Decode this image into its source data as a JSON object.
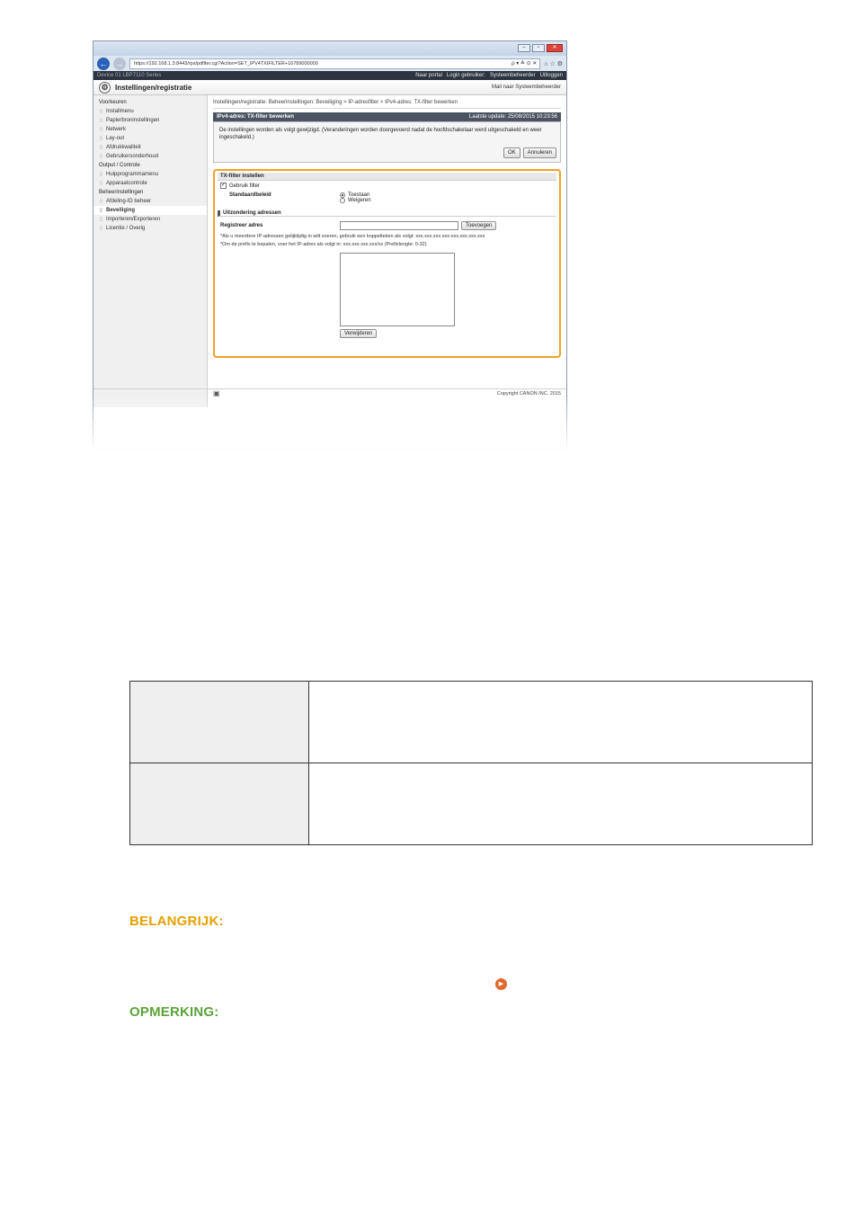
{
  "browser": {
    "url": "https://192.168.1.3:8443/rps/pdflter.cgi?Action=SET_IPV4TXIFILTER+16789000000",
    "addr_tools": "ρ ▾ ≙ ⊙ ✕",
    "tab_icons": "⌂ ☆ ⚙",
    "win_buttons": [
      "–",
      "▫",
      "✕"
    ]
  },
  "topbar": {
    "device": "Device 01   LBP7110 Series",
    "links": [
      "Naar portal",
      "Login gebruiker:",
      "Systeembeheerder",
      "Uitloggen"
    ]
  },
  "app": {
    "title": "Instellingen/registratie",
    "home_link": "Mail naar Systeembeheerder"
  },
  "sidebar": {
    "groups": [
      {
        "label": "Voorkeuren",
        "items": [
          "Installmenu",
          "Papierbroninstellingen",
          "Netwerk",
          "Lay-out",
          "Afdrukkwaliteit",
          "Gebruikersonderhoud"
        ]
      },
      {
        "label": "Output / Controle",
        "items": [
          "Hulpprogrammamenu",
          "Apparaatcontrole"
        ]
      },
      {
        "label": "Beheerinstellingen",
        "items": [
          "Afdeling-ID beheer",
          "Beveiliging",
          "Importeren/Exporteren",
          "Licentie / Overig"
        ]
      }
    ],
    "active": "Beveiliging"
  },
  "main": {
    "breadcrumb": "Instellingen/registratie: Beheerinstellingen: Beveiliging > IP-adresfilter > IPv4-adres: TX-filter bewerken",
    "header_title": "IPv4-adres: TX-filter bewerken",
    "last_update": "Laatste update: 25/08/2015 10:23:56",
    "message": "De instellingen worden als volgt gewijzigd. (Veranderingen worden doorgevoerd nadat de hoofdschakelaar werd uitgeschakeld en weer ingeschakeld.)",
    "ok_label": "OK",
    "cancel_label": "Annuleren",
    "filter_section": "TX-filter instellen",
    "use_filter_label": "Gebruik filter",
    "default_policy_label": "Standaardbeleid",
    "allow_label": "Toestaan",
    "deny_label": "Weigeren",
    "exception_section": "Uitzondering adressen",
    "register_label": "Registreer adres",
    "add_label": "Toevoegen",
    "note1": "*Als u meerdere IP-adressen gelijktijdig in wilt voeren, gebruik een koppelteken als volgt: xxx.xxx.xxx.xxx-xxx.xxx.xxx.xxx",
    "note2": "*Om de prefix te bepalen, voer het IP-adres als volgt in: xxx.xxx.xxx.xxx/xx (Prefixlengte: 0-32)",
    "remove_label": "Verwijderen"
  },
  "footer": {
    "copyright": "Copyright CANON INC. 2015"
  },
  "doc": {
    "important_label": "BELANGRIJK:",
    "note_label": "OPMERKING:"
  }
}
